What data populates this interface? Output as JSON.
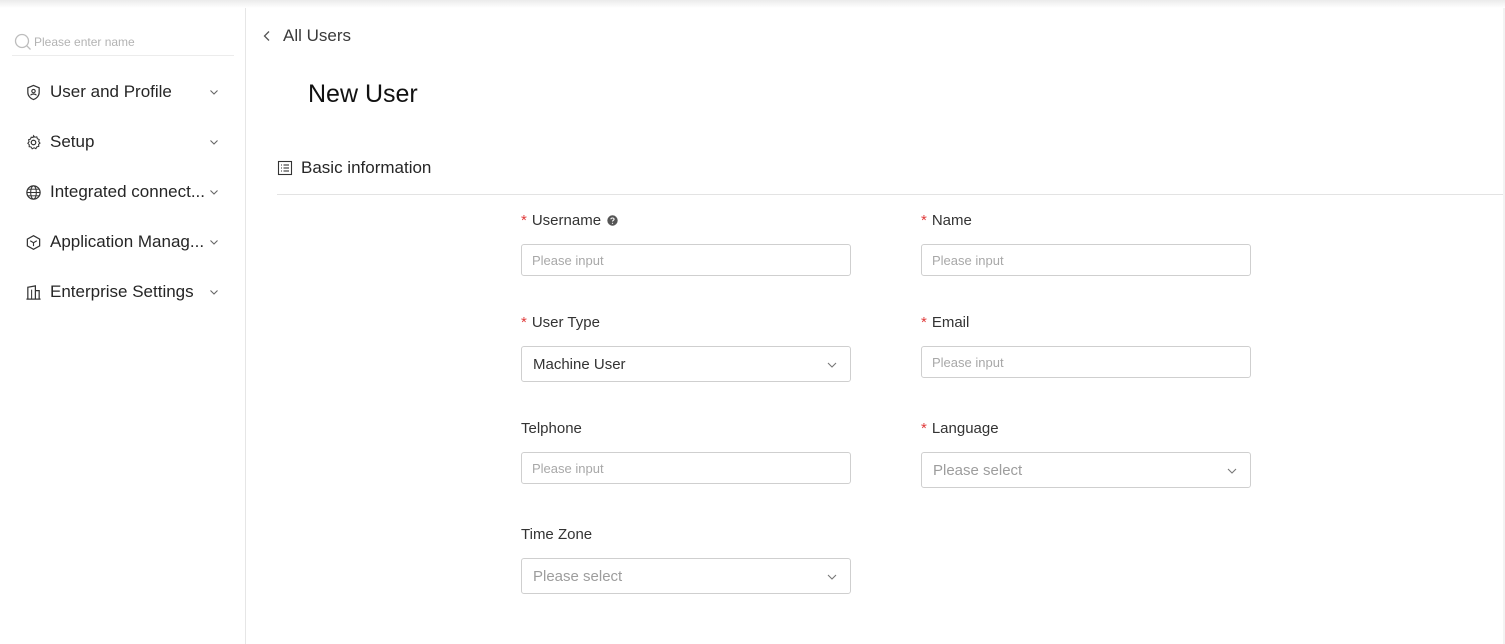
{
  "sidebar": {
    "search": {
      "placeholder": "Please enter name"
    },
    "items": [
      {
        "label": "User and Profile",
        "icon": "shield-user-icon"
      },
      {
        "label": "Setup",
        "icon": "gear-icon"
      },
      {
        "label": "Integrated connect...",
        "icon": "globe-icon"
      },
      {
        "label": "Application Manag...",
        "icon": "cube-icon"
      },
      {
        "label": "Enterprise Settings",
        "icon": "building-icon"
      }
    ]
  },
  "header": {
    "back_label": "All Users",
    "title": "New User"
  },
  "section": {
    "title": "Basic information"
  },
  "form": {
    "username": {
      "label": "Username",
      "placeholder": "Please input",
      "required": true
    },
    "name": {
      "label": "Name",
      "placeholder": "Please input",
      "required": true
    },
    "user_type": {
      "label": "User Type",
      "value": "Machine User",
      "required": true
    },
    "email": {
      "label": "Email",
      "placeholder": "Please input",
      "required": true
    },
    "telphone": {
      "label": "Telphone",
      "placeholder": "Please input",
      "required": false
    },
    "language": {
      "label": "Language",
      "placeholder": "Please select",
      "required": true
    },
    "time_zone": {
      "label": "Time Zone",
      "placeholder": "Please select",
      "required": false
    },
    "required_mark": "*"
  },
  "colors": {
    "required": "#e03a3a",
    "border": "#cfcfcf",
    "placeholder": "#a8a8a8"
  }
}
